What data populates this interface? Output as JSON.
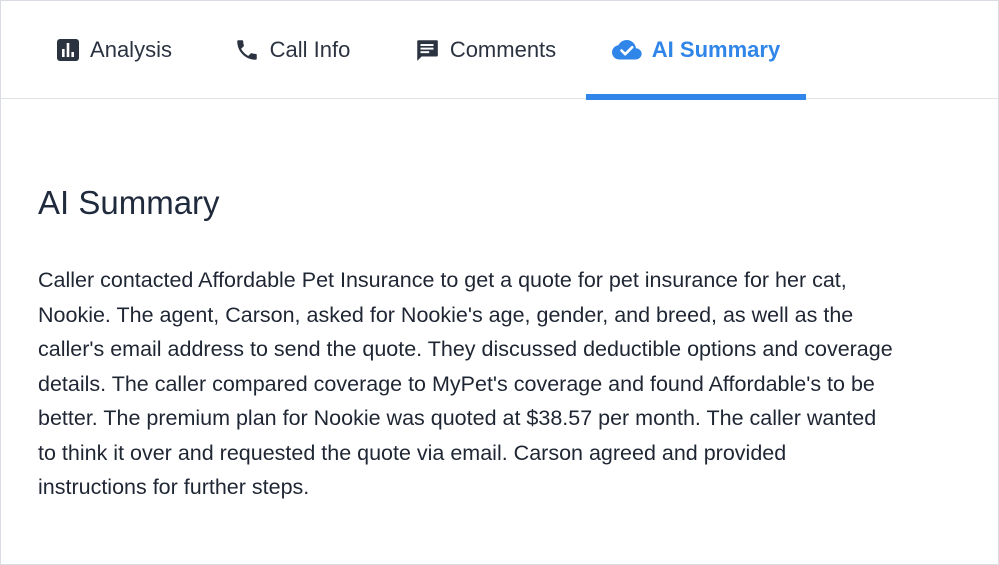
{
  "tabs": [
    {
      "label": "Analysis",
      "icon": "bar-chart-icon",
      "active": false
    },
    {
      "label": "Call Info",
      "icon": "phone-icon",
      "active": false
    },
    {
      "label": "Comments",
      "icon": "comment-icon",
      "active": false
    },
    {
      "label": "AI Summary",
      "icon": "cloud-check-icon",
      "active": true
    }
  ],
  "colors": {
    "accent": "#2f86e8",
    "text": "#2b3240",
    "divider": "#dfe3e8"
  },
  "main": {
    "title": "AI Summary",
    "summary": "Caller contacted Affordable Pet Insurance to get a quote for pet insurance for her cat, Nookie. The agent, Carson, asked for Nookie's age, gender, and breed, as well as the caller's email address to send the quote. They discussed deductible options and coverage details. The caller compared coverage to MyPet's coverage and found Affordable's to be better. The premium plan for Nookie was quoted at $38.57 per month. The caller wanted to think it over and requested the quote via email. Carson agreed and provided instructions for further steps."
  }
}
